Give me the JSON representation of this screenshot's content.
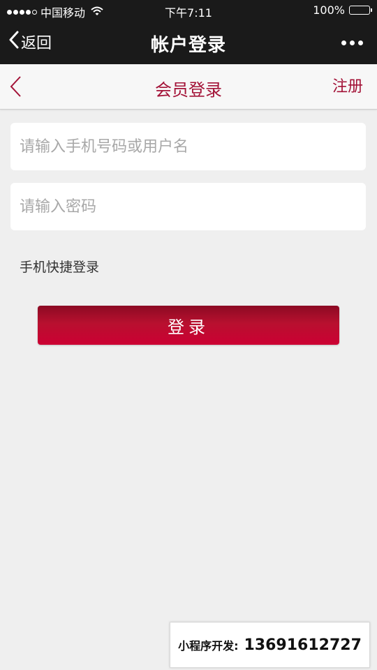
{
  "status_bar": {
    "carrier": "中国移动",
    "time": "下午7:11",
    "battery": "100%",
    "signal_bars": 4,
    "signal_total": 5
  },
  "wechat_nav": {
    "back_label": "返回",
    "title": "帐户登录"
  },
  "header": {
    "title": "会员登录",
    "register_label": "注册",
    "accent_color": "#a31237"
  },
  "form": {
    "username_placeholder": "请输入手机号码或用户名",
    "username_value": "",
    "password_placeholder": "请输入密码",
    "password_value": "",
    "quick_login_label": "手机快捷登录",
    "login_button_label": "登录",
    "button_color": "#c40032"
  },
  "dev_banner": {
    "label": "小程序开发:",
    "phone": "13691612727"
  }
}
